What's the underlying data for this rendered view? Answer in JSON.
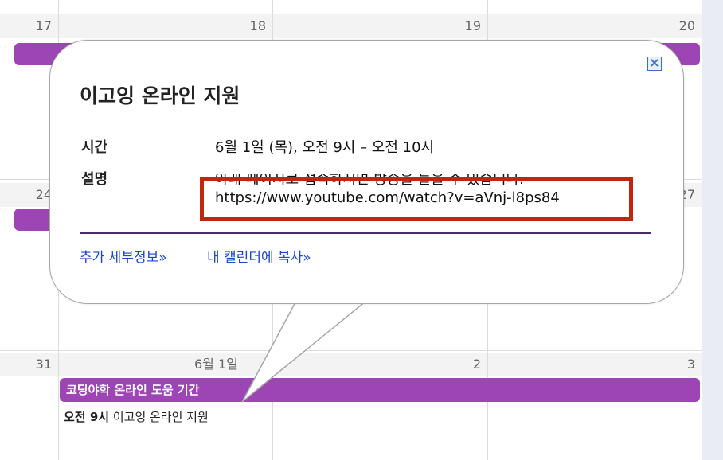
{
  "calendar": {
    "weeks": [
      {
        "days": [
          "17",
          "18",
          "19",
          "20"
        ]
      },
      {
        "days": [
          "24",
          "",
          "",
          "27"
        ]
      },
      {
        "days": [
          "31",
          "6월 1일",
          "2",
          "3"
        ]
      }
    ],
    "event_bar_label": "코딩야학 온라인 도움 기간",
    "event_item_time": "오전 9시",
    "event_item_title": "이고잉 온라인 지원"
  },
  "popup": {
    "title": "이고잉 온라인 지원",
    "time_label": "시간",
    "time_value": "6월 1일 (목), 오전 9시 – 오전 10시",
    "desc_label": "설명",
    "desc_line1": "아래 페이지로 접속하시면 방송을 들을 수 있습니다.",
    "desc_url": "https://www.youtube.com/watch?v=aVnj-l8ps84",
    "more_details_link": "추가 세부정보»",
    "copy_to_calendar_link": "내 캘린더에 복사»",
    "close_icon": "close-icon"
  },
  "colors": {
    "event_purple": "#9e45b5",
    "highlight_red": "#c0270e",
    "link_blue": "#1a47cc"
  }
}
